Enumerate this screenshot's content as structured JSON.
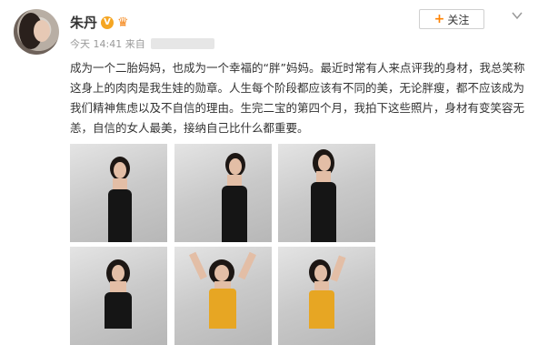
{
  "user": {
    "name": "朱丹",
    "verified_badge": "V",
    "time": "今天 14:41 来自"
  },
  "follow_button": {
    "label": "关注",
    "plus": "+"
  },
  "post_text": "成为一个二胎妈妈，也成为一个幸福的“胖”妈妈。最近时常有人来点评我的身材，我总笑称这身上的肉肉是我生娃的勋章。人生每个阶段都应该有不同的美，无论胖瘦，都不应该成为我们精神焦虑以及不自信的理由。生完二宝的第四个月，我拍下这些照片，身材有变笑容无恙，自信的女人最美，接纳自己比什么都重要。",
  "photos": [
    {
      "outfit": "black dress"
    },
    {
      "outfit": "black dress"
    },
    {
      "outfit": "black dress"
    },
    {
      "outfit": "black dress"
    },
    {
      "outfit": "orange top"
    },
    {
      "outfit": "orange top"
    }
  ],
  "colors": {
    "accent": "#ff8200",
    "verified": "#f5a623",
    "meta_text": "#999999"
  }
}
